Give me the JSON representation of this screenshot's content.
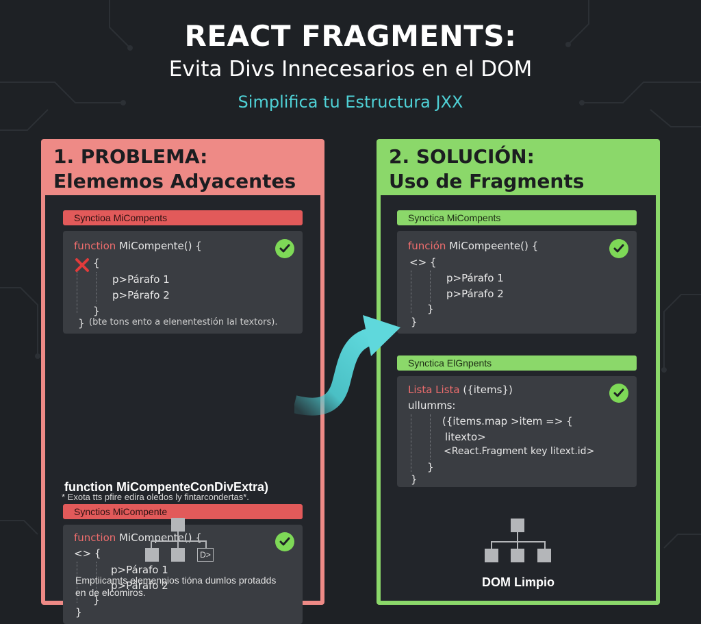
{
  "header": {
    "title": "REACT FRAGMENTS:",
    "subtitle": "Evita Divs Innecesarios en el DOM",
    "tagline": "Simplifica tu Estructura JXX"
  },
  "problem": {
    "heading_line1": "1. PROBLEMA:",
    "heading_line2": "Elememos Adyacentes",
    "label1": "Synctioa MiCompents",
    "code1": {
      "line1_kw": "function",
      "line1_rest": " MiCompente() {",
      "line2": "{",
      "line3": "p>Párafo 1",
      "line4": "p>Párafo 2",
      "line5": "}",
      "line6": "}",
      "note": "(bte tons ento a elenentestión lal textors)."
    },
    "fn_heading": "function MiCompenteConDivExtra)",
    "label2": "Synctios MiCompente",
    "code2": {
      "line1_kw": "function",
      "line1_rest": " MiCompente() {",
      "line2": "<> {",
      "line3": "p>Párafo 1",
      "line4": "p>Párafo 2",
      "line5": "}",
      "line6": "}"
    },
    "note2": "* Exota tts pfire edira oledos ly fintarcondertas*.",
    "tree_label": "D>",
    "footer_line1": "Emptiicamts elemenpios tióna dumlos protadds",
    "footer_line2": "en de elcomiros."
  },
  "solution": {
    "heading_line1": "2. SOLUCIÓN:",
    "heading_line2": "Uso de Fragments",
    "label1": "Synctica MiCompents",
    "code1": {
      "line1_kw": "función",
      "line1_rest": " MiCompeente() {",
      "line2": "<> {",
      "line3": "p>Párafo 1",
      "line4": "p>Párafo 2",
      "line5": "}",
      "line6": "}"
    },
    "label2": "Synctica ElGnpents",
    "code2": {
      "line1_kw": "Lista Lista",
      "line1_rest": " ({items})",
      "line2": "ullumms:",
      "line3": "({items.map >item => {",
      "line4": "litexto>",
      "line5": "<React.Fragment key litext.id>",
      "line6": "}",
      "line7": "}"
    },
    "dom_label": "DOM Limpio"
  },
  "colors": {
    "problem": "#ee8a86",
    "solution": "#8bd86a",
    "accent": "#4fd1d6",
    "check": "#7ed957",
    "error": "#e23b3b"
  },
  "icons": [
    "check-icon",
    "x-icon",
    "curved-arrow-icon",
    "tree-icon"
  ]
}
